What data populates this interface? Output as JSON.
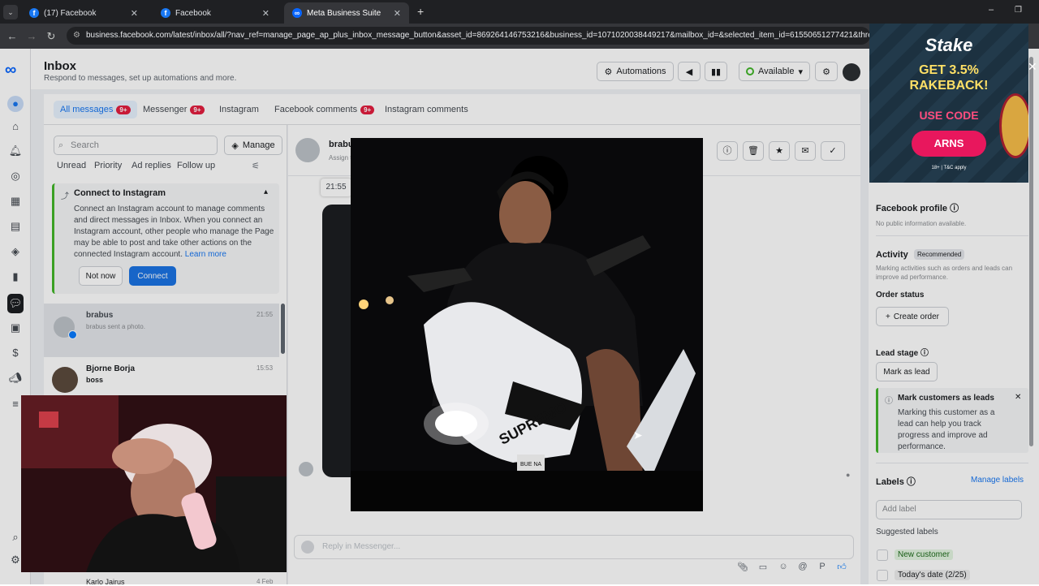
{
  "browser": {
    "tabs": [
      {
        "title": "(17) Facebook"
      },
      {
        "title": "Facebook"
      },
      {
        "title": "Meta Business Suite"
      }
    ],
    "url": "business.facebook.com/latest/inbox/all/?nav_ref=manage_page_ap_plus_inbox_message_button&asset_id=869264146753216&business_id=1071020038449217&mailbox_id=&selected_item_id=61550651277421&thread_type=FB_M"
  },
  "header": {
    "title": "Inbox",
    "subtitle": "Respond to messages, set up automations and more.",
    "automations": "Automations",
    "status": "Available"
  },
  "filter_tabs": [
    {
      "label": "All messages",
      "badge": "9+"
    },
    {
      "label": "Messenger",
      "badge": "9+"
    },
    {
      "label": "Instagram",
      "badge": ""
    },
    {
      "label": "Facebook comments",
      "badge": "9+"
    },
    {
      "label": "Instagram comments",
      "badge": ""
    }
  ],
  "left": {
    "search_placeholder": "Search",
    "manage": "Manage",
    "subfilters": [
      "Unread",
      "Priority",
      "Ad replies",
      "Follow up"
    ],
    "ig_card": {
      "title": "Connect to Instagram",
      "body": "Connect an Instagram account to manage comments and direct messages in Inbox. When you connect an Instagram account, other people who manage the Page may be able to post and take other actions on the connected Instagram account.",
      "link": "Learn more",
      "not_now": "Not now",
      "connect": "Connect"
    },
    "conversations": [
      {
        "name": "brabus",
        "preview": "brabus sent a photo.",
        "time": "21:55"
      },
      {
        "name": "Bjorne Borja",
        "preview": "boss",
        "time": "15:53"
      },
      {
        "name": "Karlo Jairus",
        "preview": "",
        "time": "4 Feb"
      }
    ]
  },
  "conversation": {
    "name": "brabu",
    "assign": "Assign t",
    "time_chip": "21:55",
    "reply_placeholder": "Reply in Messenger..."
  },
  "right": {
    "fb_profile": "Facebook profile",
    "no_info": "No public information available.",
    "activity": "Activity",
    "recommended": "Recommended",
    "activity_desc": "Marking activities such as orders and leads can improve ad performance.",
    "order_status": "Order status",
    "create_order": "Create order",
    "lead_stage": "Lead stage",
    "mark_as_lead": "Mark as lead",
    "tip_title": "Mark customers as leads",
    "tip_body": "Marking this customer as a lead can help you track progress and improve ad performance.",
    "labels": "Labels",
    "manage_labels": "Manage labels",
    "add_label": "Add label",
    "suggested": "Suggested labels",
    "new_customer": "New customer",
    "todays_date": "Today's date (2/25)"
  },
  "ad": {
    "brand": "Stake",
    "headline": "GET 3.5% RAKEBACK!",
    "use_code": "USE CODE",
    "code": "ARNS",
    "terms": "18+ | T&C apply"
  },
  "photo_text": "SUPREMO",
  "plate": "BUE NA",
  "colors": {
    "accent": "#1877f2",
    "connect": "#1b74e4",
    "badge": "#e41e3f",
    "ad_pink": "#e8175d"
  }
}
